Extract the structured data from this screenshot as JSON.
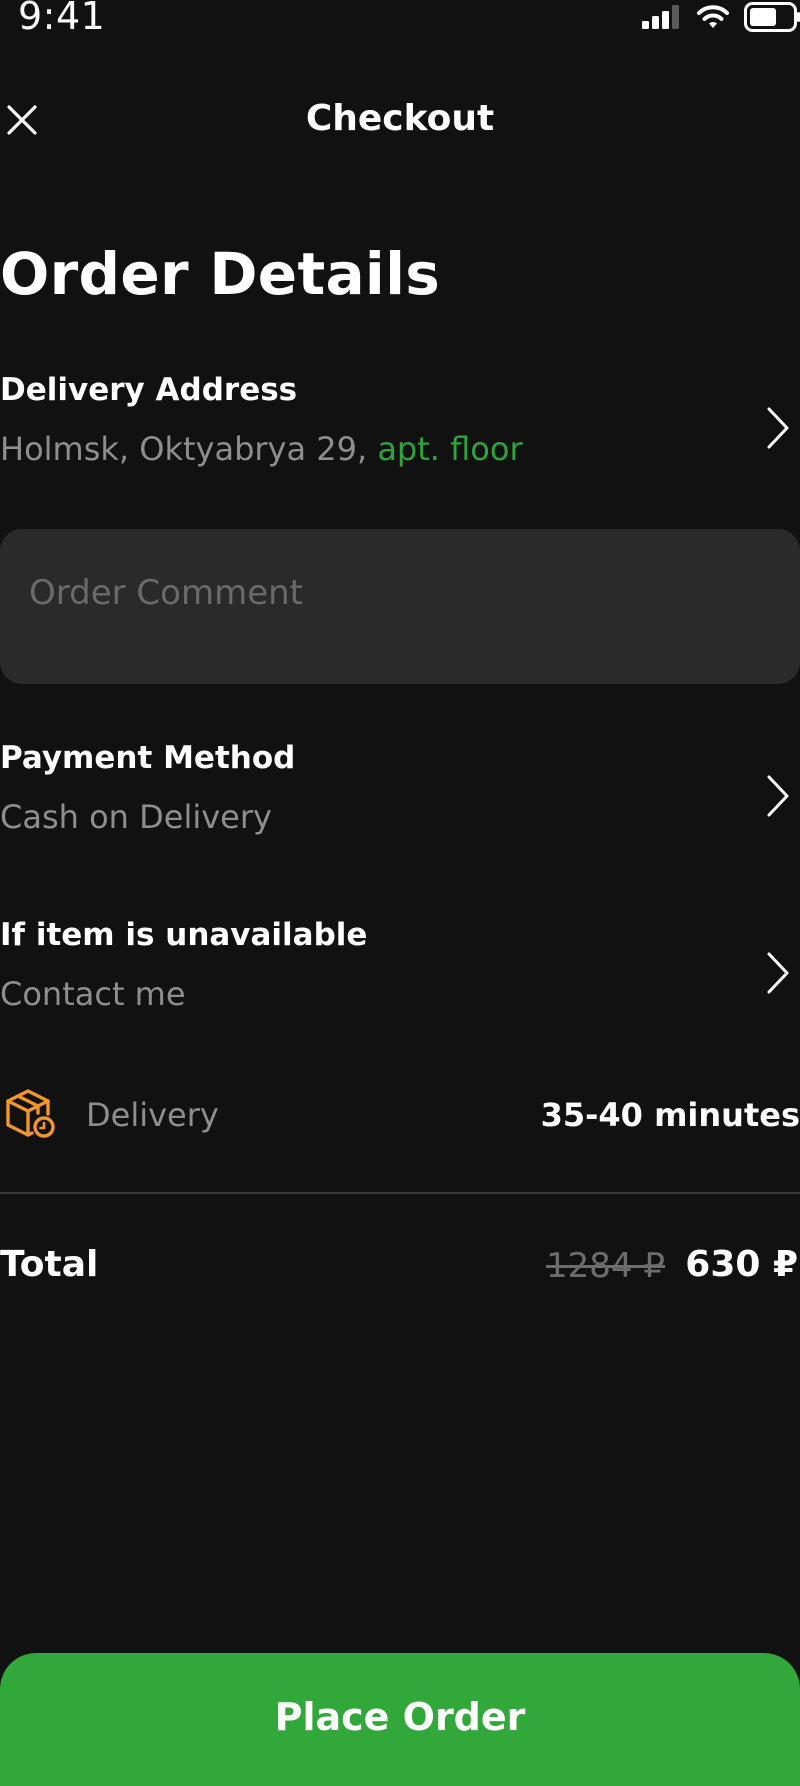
{
  "status_bar": {
    "time": "9:41"
  },
  "nav": {
    "title": "Checkout"
  },
  "page_title": "Order Details",
  "delivery_address": {
    "title": "Delivery Address",
    "address": "Holmsk, Oktyabrya 29,",
    "detail": "apt. floor"
  },
  "comment": {
    "placeholder": "Order Comment"
  },
  "payment": {
    "title": "Payment Method",
    "value": "Cash on Delivery"
  },
  "unavailable": {
    "title": "If item is unavailable",
    "value": "Contact me"
  },
  "delivery": {
    "label": "Delivery",
    "time": "35-40 minutes"
  },
  "total": {
    "label": "Total",
    "old_price": "1284 ₽",
    "price": "630 ₽"
  },
  "cta": {
    "label": "Place Order"
  },
  "colors": {
    "background": "#111111",
    "accent": "#31a839",
    "accent_text": "#2fa23a",
    "icon_orange": "#f0962a"
  }
}
